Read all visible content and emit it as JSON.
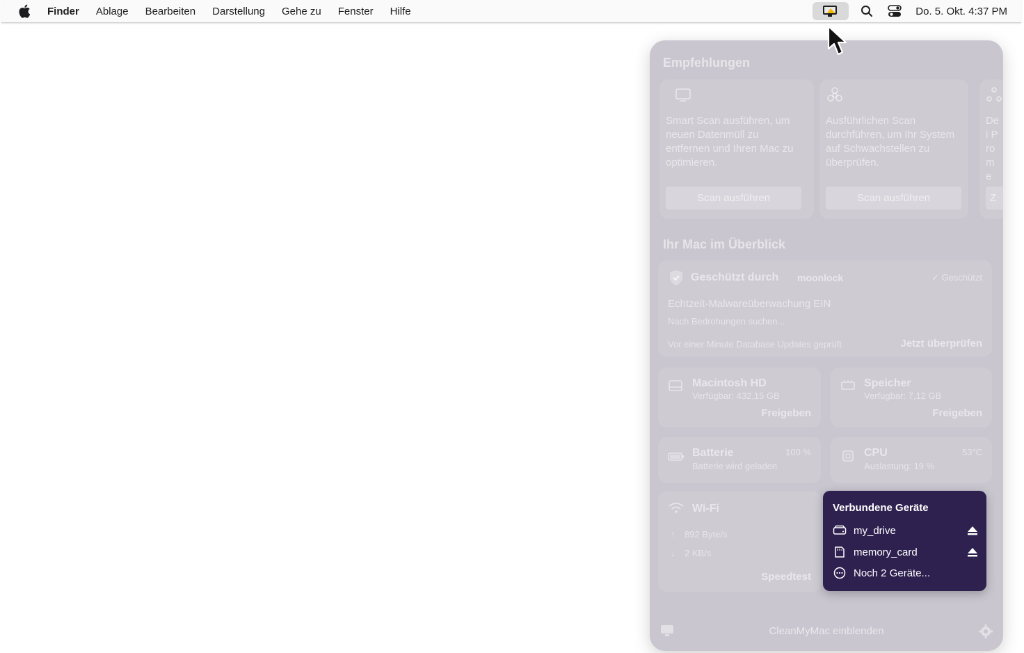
{
  "menubar": {
    "apple_icon": "apple-logo-icon",
    "app_name": "Finder",
    "items": [
      "Ablage",
      "Bearbeiten",
      "Darstellung",
      "Gehe zu",
      "Fenster",
      "Hilfe"
    ],
    "clock": "Do. 5. Okt.  4:37 PM"
  },
  "panel": {
    "recommendations": {
      "title": "Empfehlungen",
      "cards": [
        {
          "text": "Smart Scan ausführen, um neuen Datenmüll zu entfernen und Ihren Mac zu optimieren.",
          "button": "Scan ausführen"
        },
        {
          "text": "Ausführlichen Scan durchführen, um Ihr System auf Schwachstellen zu überprüfen.",
          "button": "Scan ausführen"
        },
        {
          "text": "Dei Pro me",
          "button": "Z"
        }
      ]
    },
    "overview": {
      "title": "Ihr Mac im Überblick",
      "protection": {
        "label": "Geschützt durch",
        "brand": "moonlock",
        "status": "Geschützt",
        "realtime": "Echtzeit-Malwareüberwachung EIN",
        "searching": "Nach Bedrohungen suchen...",
        "db_updates": "Vor einer Minute Database Updates geprüft",
        "action": "Jetzt überprüfen"
      },
      "disk": {
        "title": "Macintosh HD",
        "sub": "Verfügbar: 432,15 GB",
        "action": "Freigeben"
      },
      "memory": {
        "title": "Speicher",
        "sub": "Verfügbar: 7,12 GB",
        "action": "Freigeben"
      },
      "battery": {
        "title": "Batterie",
        "value": "100 %",
        "sub": "Batterie wird geladen"
      },
      "cpu": {
        "title": "CPU",
        "value": "53°C",
        "sub": "Auslastung: 19 %"
      },
      "wifi": {
        "title": "Wi-Fi",
        "up": "892 Byte/s",
        "down": "2 KB/s",
        "action": "Speedtest"
      }
    },
    "footer": {
      "label": "CleanMyMac einblenden"
    }
  },
  "devices": {
    "title": "Verbundene Geräte",
    "items": [
      {
        "name": "my_drive",
        "icon": "drive-icon",
        "eject": true
      },
      {
        "name": "memory_card",
        "icon": "sd-card-icon",
        "eject": true
      },
      {
        "name": "Noch 2 Geräte...",
        "icon": "more-icon",
        "eject": false
      }
    ]
  }
}
